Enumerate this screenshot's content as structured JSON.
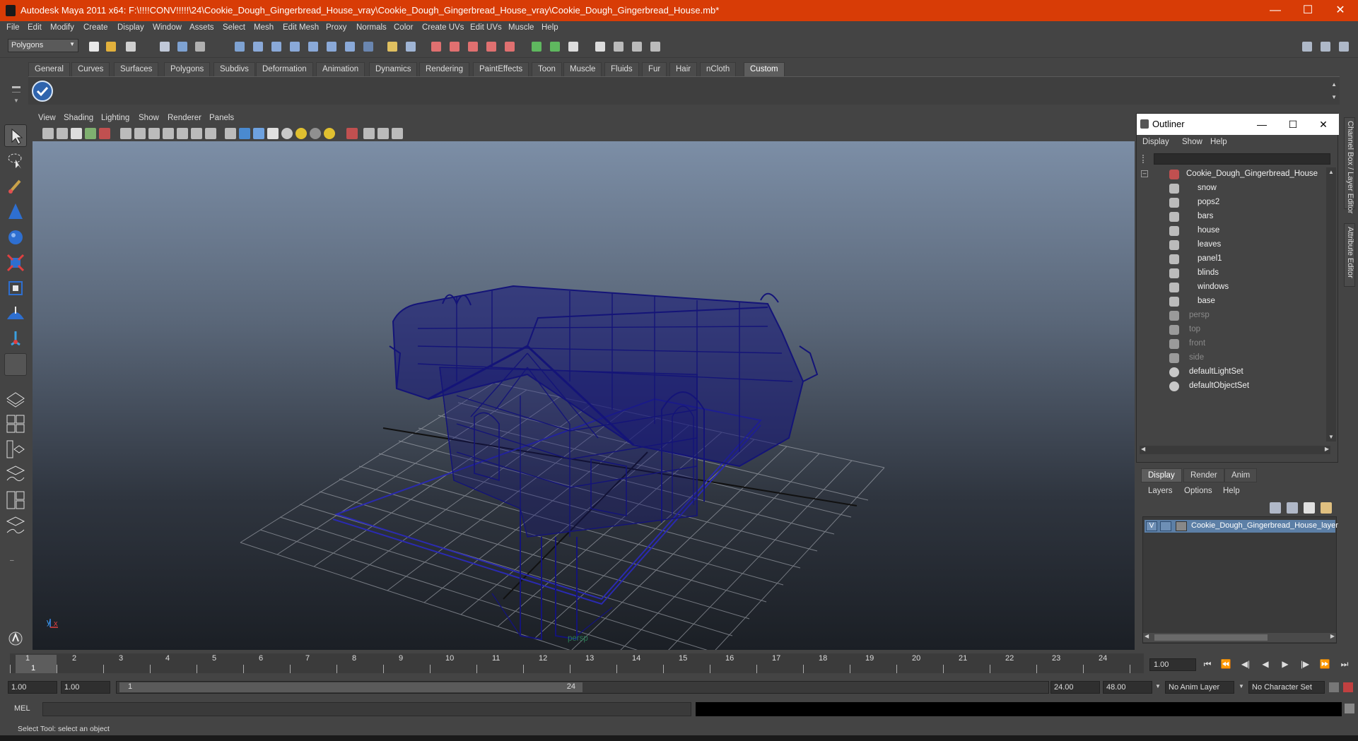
{
  "window": {
    "title": "Autodesk Maya 2011 x64: F:\\!!!!CONV!!!!!\\24\\Cookie_Dough_Gingerbread_House_vray\\Cookie_Dough_Gingerbread_House_vray\\Cookie_Dough_Gingerbread_House.mb*"
  },
  "menu": [
    "File",
    "Edit",
    "Modify",
    "Create",
    "Display",
    "Window",
    "Assets",
    "Select",
    "Mesh",
    "Edit Mesh",
    "Proxy",
    "Normals",
    "Color",
    "Create UVs",
    "Edit UVs",
    "Muscle",
    "Help"
  ],
  "statusline": {
    "mode": "Polygons"
  },
  "shelf": {
    "tabs": [
      "General",
      "Curves",
      "Surfaces",
      "Polygons",
      "Subdivs",
      "Deformation",
      "Animation",
      "Dynamics",
      "Rendering",
      "PaintEffects",
      "Toon",
      "Muscle",
      "Fluids",
      "Fur",
      "Hair",
      "nCloth",
      "Custom"
    ],
    "active": "Custom"
  },
  "viewport": {
    "menu": [
      "View",
      "Shading",
      "Lighting",
      "Show",
      "Renderer",
      "Panels"
    ],
    "camera": "persp"
  },
  "outliner": {
    "title": "Outliner",
    "menu": [
      "Display",
      "Show",
      "Help"
    ],
    "items": [
      {
        "label": "Cookie_Dough_Gingerbread_House",
        "level": 0,
        "type": "group"
      },
      {
        "label": "snow",
        "level": 1,
        "type": "mesh"
      },
      {
        "label": "pops2",
        "level": 1,
        "type": "mesh"
      },
      {
        "label": "bars",
        "level": 1,
        "type": "mesh"
      },
      {
        "label": "house",
        "level": 1,
        "type": "mesh"
      },
      {
        "label": "leaves",
        "level": 1,
        "type": "mesh"
      },
      {
        "label": "panel1",
        "level": 1,
        "type": "mesh"
      },
      {
        "label": "blinds",
        "level": 1,
        "type": "mesh"
      },
      {
        "label": "windows",
        "level": 1,
        "type": "mesh"
      },
      {
        "label": "base",
        "level": 1,
        "type": "mesh"
      },
      {
        "label": "persp",
        "level": 0,
        "type": "camera"
      },
      {
        "label": "top",
        "level": 0,
        "type": "camera"
      },
      {
        "label": "front",
        "level": 0,
        "type": "camera"
      },
      {
        "label": "side",
        "level": 0,
        "type": "camera"
      },
      {
        "label": "defaultLightSet",
        "level": 0,
        "type": "set"
      },
      {
        "label": "defaultObjectSet",
        "level": 0,
        "type": "set"
      }
    ]
  },
  "layers": {
    "tabs": [
      "Display",
      "Render",
      "Anim"
    ],
    "active": "Display",
    "menu": [
      "Layers",
      "Options",
      "Help"
    ],
    "rows": [
      {
        "visible": "V",
        "name": "Cookie_Dough_Gingerbread_House_layer"
      }
    ]
  },
  "sidetabs": [
    "Channel Box / Layer Editor",
    "Attribute Editor"
  ],
  "time": {
    "ticks": [
      "1",
      "2",
      "3",
      "4",
      "5",
      "6",
      "7",
      "8",
      "9",
      "10",
      "11",
      "12",
      "13",
      "14",
      "15",
      "16",
      "17",
      "18",
      "19",
      "20",
      "21",
      "22",
      "23",
      "24"
    ],
    "current_frame_marker": "1",
    "current_frame": "1.00"
  },
  "range": {
    "start_time": "1.00",
    "playback_start": "1.00",
    "range_start": "1",
    "range_end": "24",
    "playback_end": "24.00",
    "end_time": "48.00",
    "anim_layer": "No Anim Layer",
    "character_set": "No Character Set"
  },
  "command": {
    "label": "MEL"
  },
  "status": {
    "help": "Select Tool: select an object"
  },
  "colors": {
    "title_bar": "#d83c06",
    "wireframe": "#141478",
    "selection": "#5c7fa6"
  }
}
